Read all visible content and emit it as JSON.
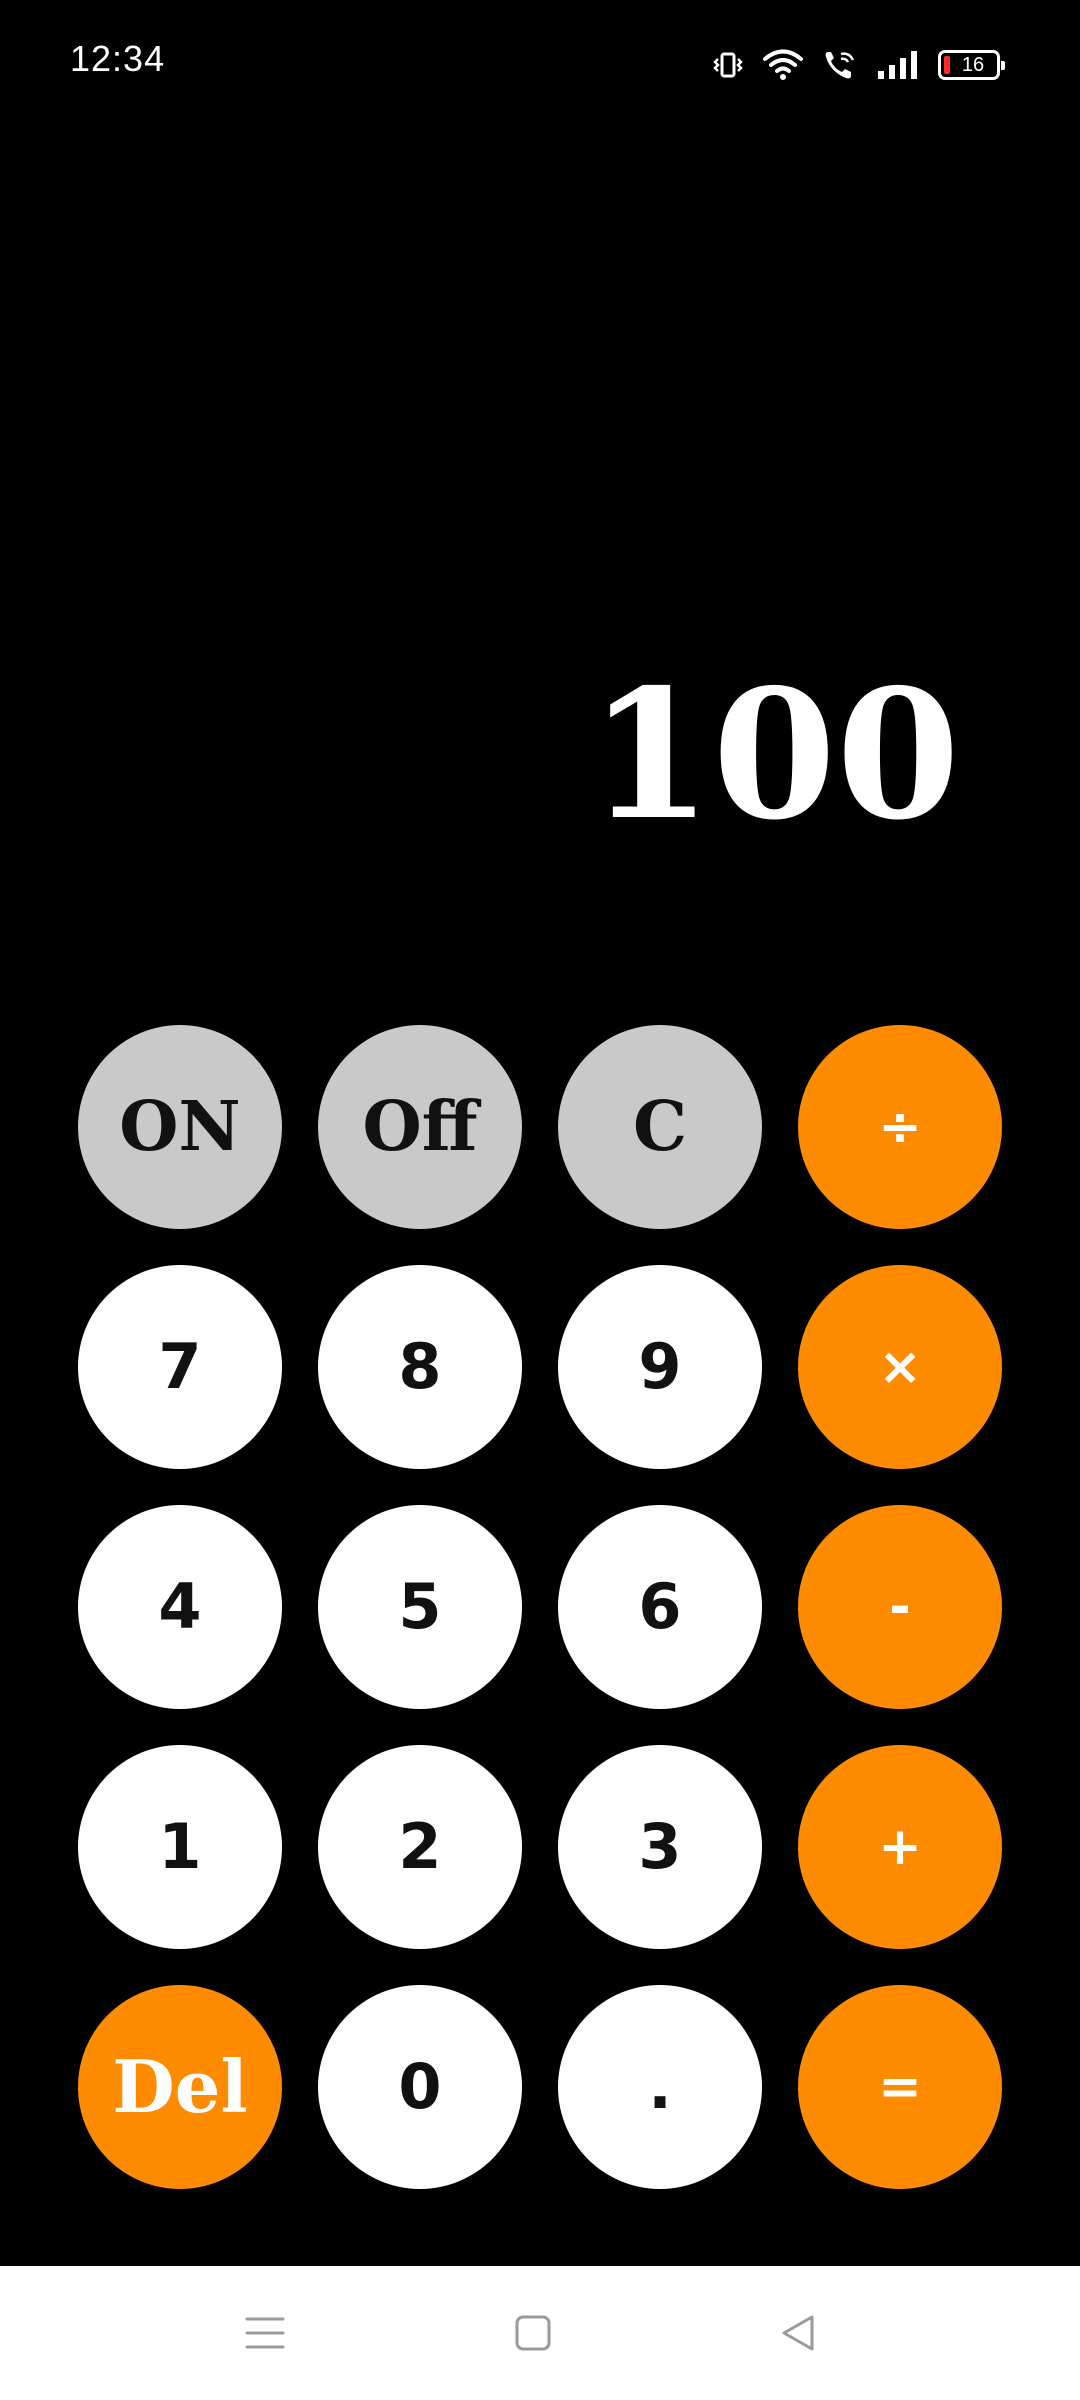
{
  "status_bar": {
    "time": "12:34",
    "battery_level": "16",
    "icons": [
      "vibrate-icon",
      "wifi-icon",
      "wifi-calling-icon",
      "signal-icon",
      "battery-icon"
    ]
  },
  "display": {
    "value": "100"
  },
  "keypad": {
    "rows": [
      [
        {
          "label": "ON",
          "style": "gray"
        },
        {
          "label": "Off",
          "style": "gray"
        },
        {
          "label": "C",
          "style": "gray"
        },
        {
          "label": "÷",
          "style": "orange"
        }
      ],
      [
        {
          "label": "7",
          "style": "white"
        },
        {
          "label": "8",
          "style": "white"
        },
        {
          "label": "9",
          "style": "white"
        },
        {
          "label": "×",
          "style": "orange"
        }
      ],
      [
        {
          "label": "4",
          "style": "white"
        },
        {
          "label": "5",
          "style": "white"
        },
        {
          "label": "6",
          "style": "white"
        },
        {
          "label": "-",
          "style": "orange"
        }
      ],
      [
        {
          "label": "1",
          "style": "white"
        },
        {
          "label": "2",
          "style": "white"
        },
        {
          "label": "3",
          "style": "white"
        },
        {
          "label": "+",
          "style": "orange"
        }
      ],
      [
        {
          "label": "Del",
          "style": "orange"
        },
        {
          "label": "0",
          "style": "white"
        },
        {
          "label": ".",
          "style": "white"
        },
        {
          "label": "=",
          "style": "orange"
        }
      ]
    ]
  },
  "colors": {
    "background": "#000000",
    "function_key": "#c9c9c9",
    "digit_key": "#ffffff",
    "operator_key": "#ff8b00",
    "battery_low": "#ff2a2a"
  },
  "nav_bar": {
    "icons": [
      "menu-icon",
      "home-icon",
      "back-icon"
    ]
  }
}
